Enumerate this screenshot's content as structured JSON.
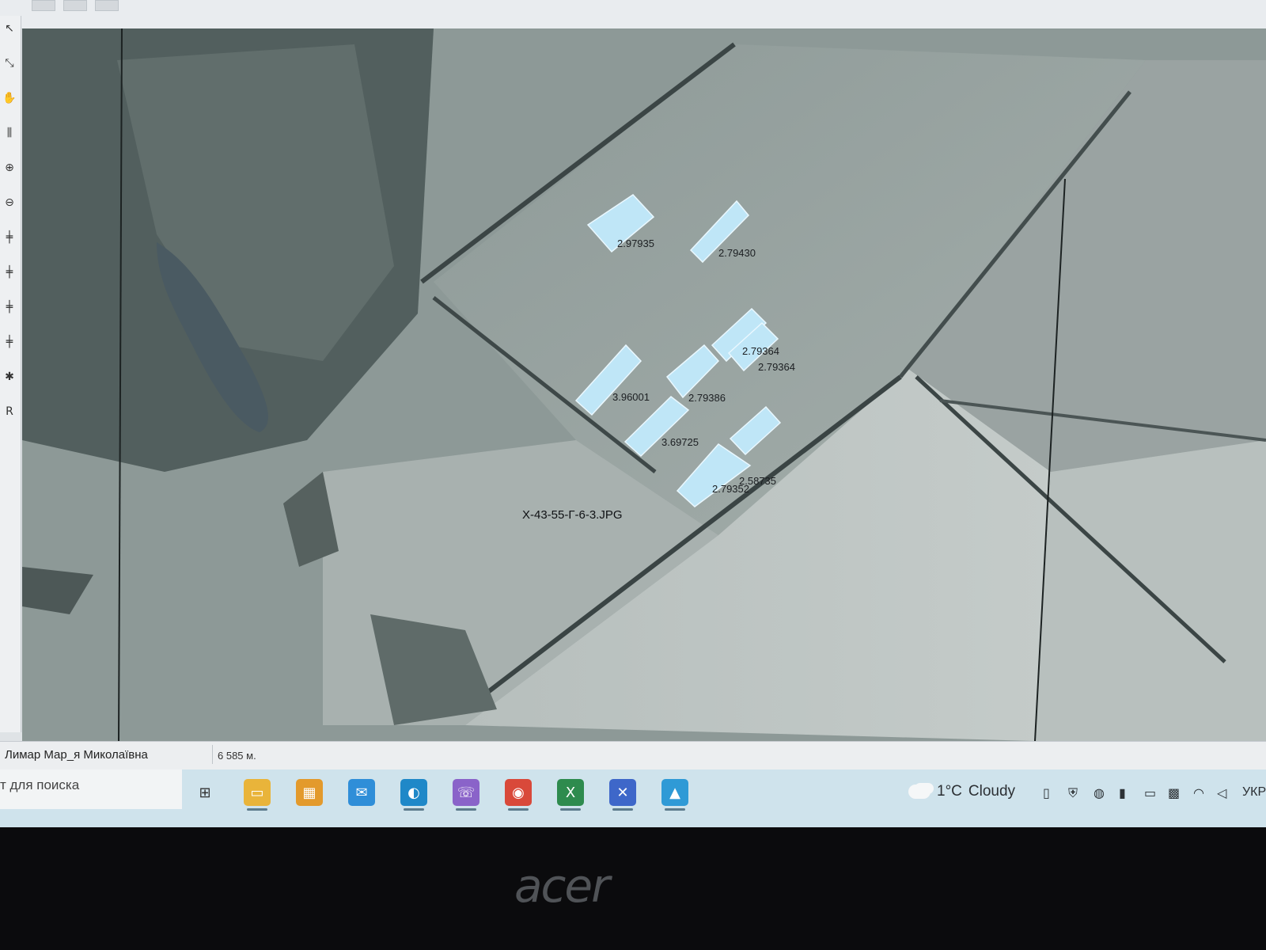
{
  "map": {
    "raster_name": "X-43-55-Г-6-3.JPG",
    "parcels": [
      {
        "id": "p1",
        "label": "2.97935"
      },
      {
        "id": "p2",
        "label": "2.79430"
      },
      {
        "id": "p3",
        "label": "3.96001"
      },
      {
        "id": "p4",
        "label": "2.79386"
      },
      {
        "id": "p5",
        "label": "2.79364"
      },
      {
        "id": "p6",
        "label": "2.79364"
      },
      {
        "id": "p7",
        "label": "3.69725"
      },
      {
        "id": "p8",
        "label": "2.58735"
      },
      {
        "id": "p9",
        "label": "2.79352"
      }
    ],
    "parcel_fill": "#bfe6f7",
    "parcel_stroke": "#eaf8ff"
  },
  "toolbar": {
    "tools": [
      {
        "name": "pointer-icon",
        "glyph": "↖"
      },
      {
        "name": "select-icon",
        "glyph": "⤡"
      },
      {
        "name": "hand-icon",
        "glyph": "✋"
      },
      {
        "name": "measure-icon",
        "glyph": "⫼"
      },
      {
        "name": "zoom-in-icon",
        "glyph": "⊕"
      },
      {
        "name": "zoom-out-icon",
        "glyph": "⊖"
      },
      {
        "name": "add-vertex-icon",
        "glyph": "╪"
      },
      {
        "name": "move-vertex-icon",
        "glyph": "╪"
      },
      {
        "name": "split-icon",
        "glyph": "╪"
      },
      {
        "name": "join-icon",
        "glyph": "╪"
      },
      {
        "name": "delete-icon",
        "glyph": "✱"
      },
      {
        "name": "r-icon",
        "glyph": "R"
      }
    ]
  },
  "status": {
    "user": "Лимар Мар_я Миколаївна",
    "scale": "6 585 м."
  },
  "taskbar": {
    "search_text": "т для поиска",
    "apps": [
      {
        "name": "task-view-icon",
        "glyph": "⊞",
        "color": "#cfe3ec"
      },
      {
        "name": "file-explorer-icon",
        "glyph": "▭",
        "color": "#e9b43a"
      },
      {
        "name": "store-icon",
        "glyph": "▦",
        "color": "#e39a2c"
      },
      {
        "name": "mail-icon",
        "glyph": "✉",
        "color": "#2f8ed8"
      },
      {
        "name": "edge-icon",
        "glyph": "◐",
        "color": "#1f88c8"
      },
      {
        "name": "viber-icon",
        "glyph": "☏",
        "color": "#8a63c9"
      },
      {
        "name": "chrome-icon",
        "glyph": "◉",
        "color": "#d9493a"
      },
      {
        "name": "excel-icon",
        "glyph": "X",
        "color": "#2e8b4e"
      },
      {
        "name": "gis-app-icon",
        "glyph": "✕",
        "color": "#3e67c9"
      },
      {
        "name": "photos-icon",
        "glyph": "▲",
        "color": "#2f9ad6"
      }
    ],
    "weather_temp": "1°C",
    "weather_text": "Cloudy",
    "lang": "УКР"
  },
  "bezel": {
    "brand": "acer"
  }
}
